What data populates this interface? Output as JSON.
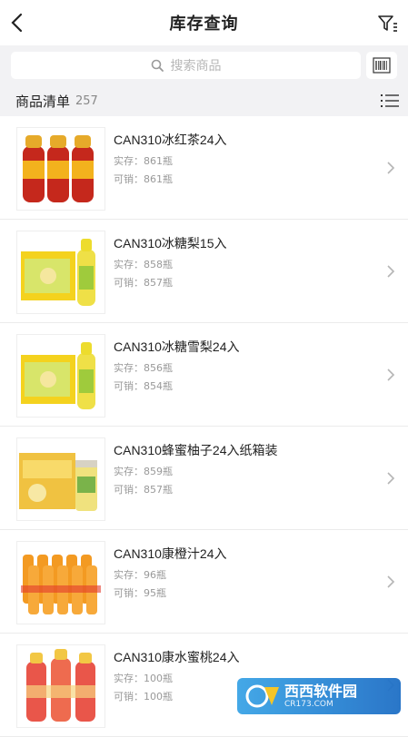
{
  "header": {
    "title": "库存查询"
  },
  "search": {
    "placeholder": "搜索商品"
  },
  "list": {
    "title": "商品清单",
    "count": "257"
  },
  "labels": {
    "stock": "实存：",
    "sellable": "可销："
  },
  "items": [
    {
      "name": "CAN310冰红茶24入",
      "stock": "861瓶",
      "sellable": "861瓶",
      "image": "ice-tea-bottles"
    },
    {
      "name": "CAN310冰糖梨15入",
      "stock": "858瓶",
      "sellable": "857瓶",
      "image": "pear-drink-box"
    },
    {
      "name": "CAN310冰糖雪梨24入",
      "stock": "856瓶",
      "sellable": "854瓶",
      "image": "pear-drink-box"
    },
    {
      "name": "CAN310蜂蜜柚子24入纸箱装",
      "stock": "859瓶",
      "sellable": "857瓶",
      "image": "honey-pomelo-box"
    },
    {
      "name": "CAN310康橙汁24入",
      "stock": "96瓶",
      "sellable": "95瓶",
      "image": "orange-juice-pack"
    },
    {
      "name": "CAN310康水蜜桃24入",
      "stock": "100瓶",
      "sellable": "100瓶",
      "image": "peach-drink-bottles"
    }
  ],
  "watermark": {
    "title": "西西软件园",
    "subtitle": "CR173.COM"
  },
  "colors": {
    "accent": "#1f6fc6",
    "muted_text": "#999999",
    "background": "#f2f2f4"
  }
}
